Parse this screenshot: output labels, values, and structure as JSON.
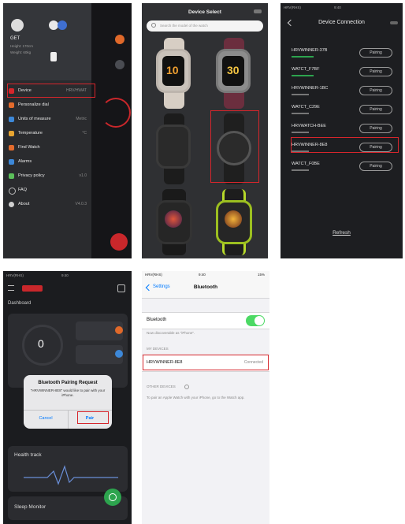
{
  "panel1": {
    "status_time": "",
    "user_name": "GET",
    "user_lines": [
      "Height: 170cm",
      "Weight: 60kg"
    ],
    "menu": [
      {
        "label": "Device",
        "right": "HRV/HWAT"
      },
      {
        "label": "Personalize dial",
        "right": ""
      },
      {
        "label": "Units of measure",
        "right": "Metric"
      },
      {
        "label": "Temperature",
        "right": "°C"
      },
      {
        "label": "Find Watch",
        "right": ""
      },
      {
        "label": "Alarms",
        "right": ""
      },
      {
        "label": "Privacy policy",
        "right": "v1.0"
      },
      {
        "label": "FAQ",
        "right": ""
      },
      {
        "label": "About",
        "right": "V4.0.3"
      }
    ],
    "colors": {
      "highlight": "#d6262c",
      "accent": "#c9272b"
    }
  },
  "panel2": {
    "title": "Device Select",
    "search_placeholder": "Search the model of the watch",
    "watch_faces": [
      "10",
      "30"
    ]
  },
  "panel3": {
    "status_left": "HRV(RHS)",
    "status_time": "9:40",
    "title": "Device Connection",
    "top_right": "",
    "devices": [
      {
        "name": "HRVWINNER-37B",
        "sub": "",
        "button": "Pairing"
      },
      {
        "name": "WATCT_F7BF",
        "sub": "",
        "button": "Pairing"
      },
      {
        "name": "HRVWINNER-1BC",
        "sub": "",
        "button": "Pairing"
      },
      {
        "name": "WATCT_C29E",
        "sub": "",
        "button": "Pairing"
      },
      {
        "name": "HRVWATCH-BEE",
        "sub": "",
        "button": "Pairing"
      },
      {
        "name": "HRVWINNER-8E8",
        "sub": "",
        "button": "Pairing"
      },
      {
        "name": "WATCT_F0BE",
        "sub": "",
        "button": "Pairing"
      }
    ],
    "refresh": "Refresh"
  },
  "panel4": {
    "status_left": "HRV(RHS)",
    "status_time": "9:40",
    "header_badge": "",
    "dashboard": "Dashboard",
    "steps_value": "0",
    "dialog_title": "Bluetooth Pairing Request",
    "dialog_body": "\"HRVWINNER-8E8\" would like to pair with your iPhone.",
    "cancel": "Cancel",
    "pair": "Pair",
    "card_health": "Health track",
    "card_sleep": "Sleep Monitor"
  },
  "panel5": {
    "status_left": "HRV(RHS)",
    "status_time": "9:40",
    "status_right": "15%",
    "back": "Settings",
    "title": "Bluetooth",
    "bluetooth_label": "Bluetooth",
    "discoverable": "Now discoverable as \"iPhone\".",
    "section_devices": "MY DEVICES",
    "device_name": "HRVWINNER-8E8",
    "device_status": "Connected",
    "section_other": "OTHER DEVICES",
    "footer": "To pair an Apple Watch with your iPhone, go to the Watch app.",
    "colors": {
      "toggle_on": "#4cd964",
      "link": "#007aff"
    }
  }
}
